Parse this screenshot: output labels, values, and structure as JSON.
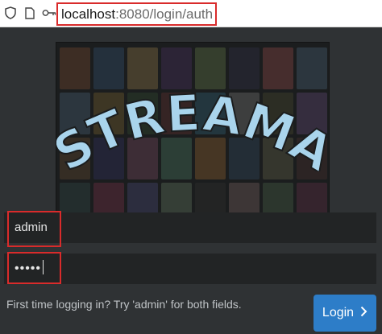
{
  "browser": {
    "url_host": "localhost",
    "url_rest": ":8080/login/auth",
    "icons": [
      "shield-icon",
      "page-icon",
      "key-icon"
    ]
  },
  "login": {
    "logo_text": "STREAMA",
    "username_value": "admin",
    "password_masked": "•••••",
    "hint": "First time logging in? Try 'admin' for both fields.",
    "button_label": "Login",
    "button_icon": "chevron-right-icon"
  },
  "colors": {
    "accent": "#2d7dc8",
    "highlight": "#d92b2b",
    "logo": "#a9d4ec",
    "background": "#2f3234"
  }
}
